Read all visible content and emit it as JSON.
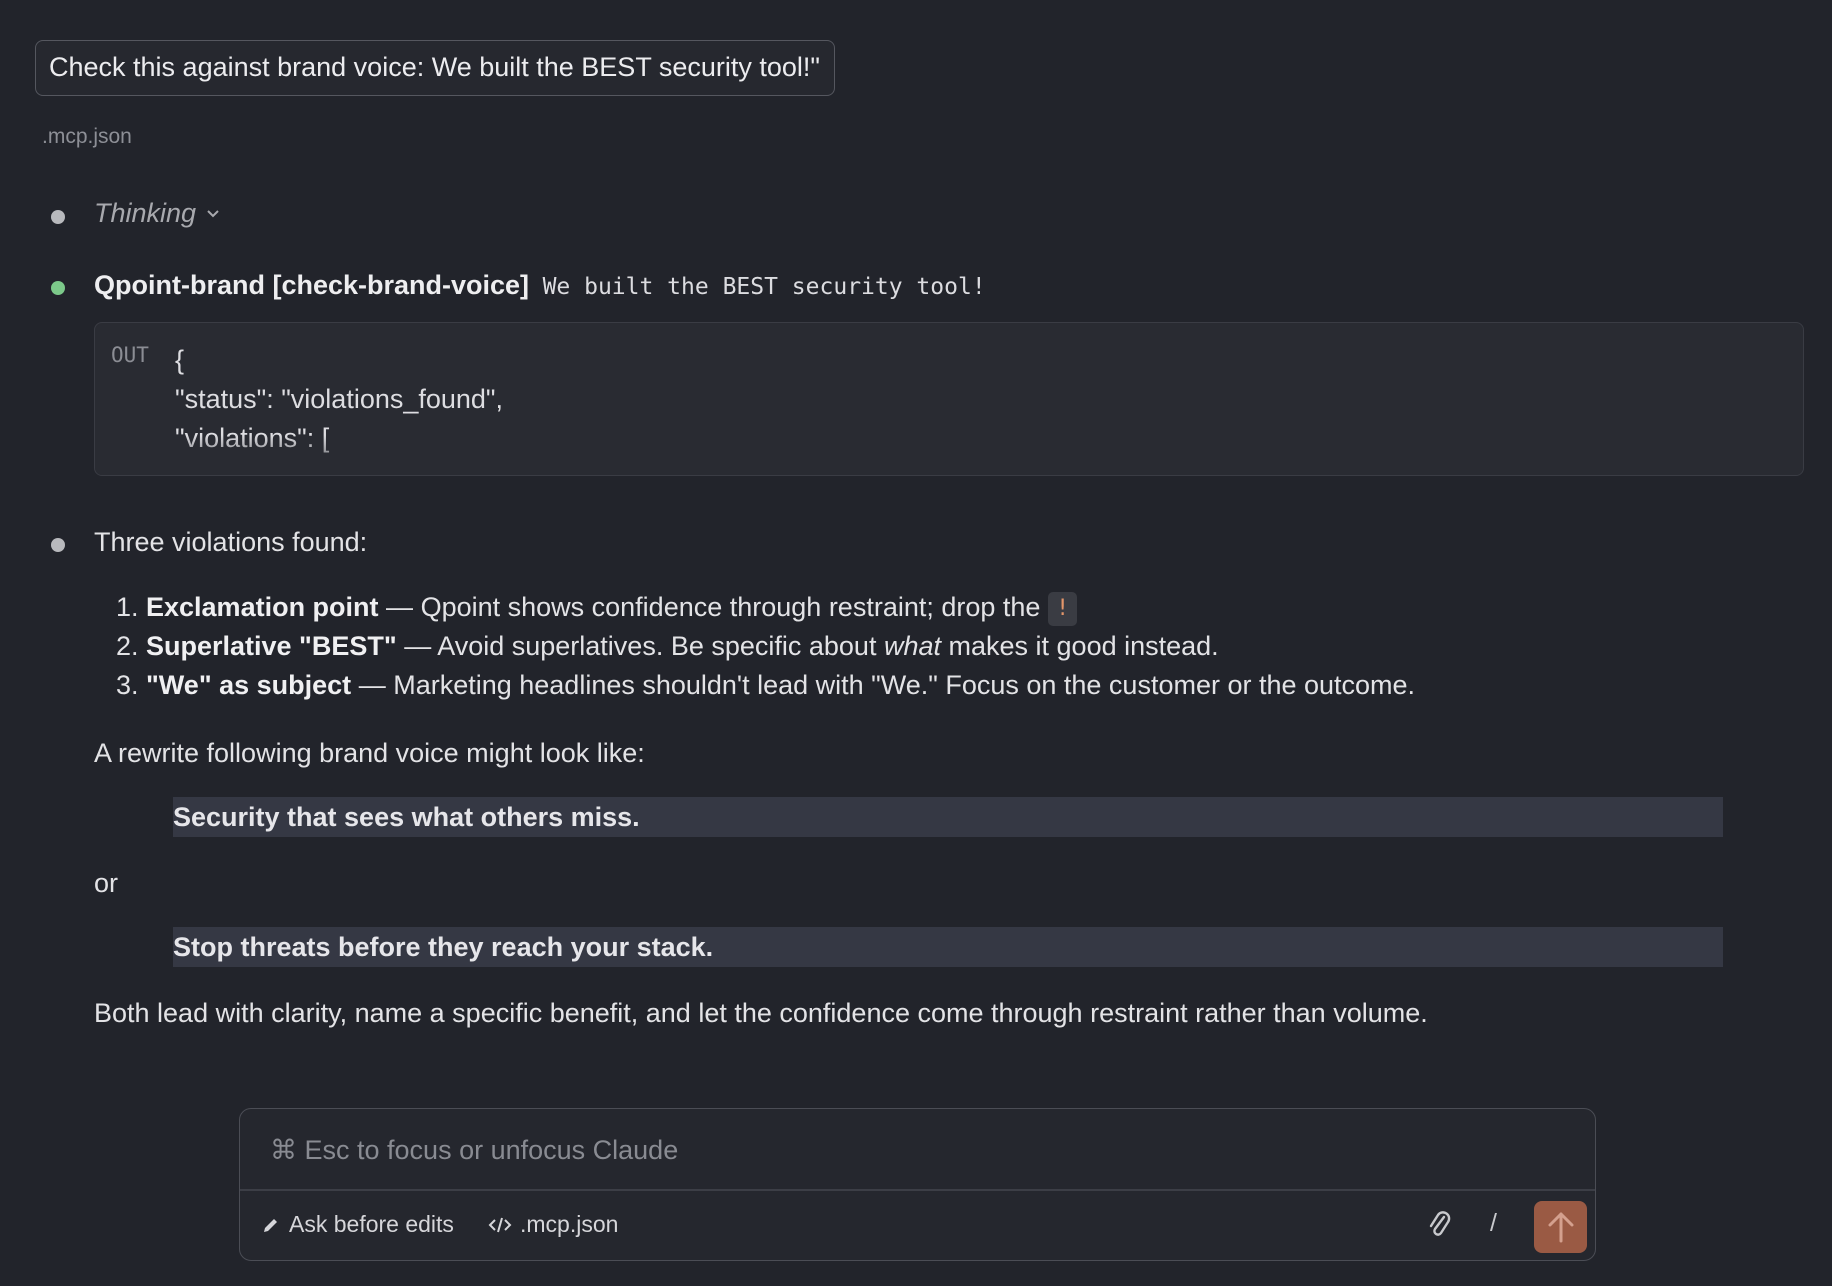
{
  "user_message": "Check this against brand voice: We built the BEST security tool!\"",
  "context_file": ".mcp.json",
  "thinking_label": "Thinking",
  "tool_call": {
    "name": "Qpoint-brand [check-brand-voice]",
    "argument": "We built the BEST security tool!",
    "output_label": "OUT",
    "output_text": "{\n\"status\": \"violations_found\",\n\"violations\": ["
  },
  "response": {
    "intro": "Three violations found:",
    "violations": [
      {
        "title": "Exclamation point",
        "sep": " — ",
        "text": "Qpoint shows confidence through restraint; drop the ",
        "code": "!"
      },
      {
        "title": "Superlative \"BEST\"",
        "sep": " — ",
        "text_before": "Avoid superlatives. Be specific about ",
        "emphasis": "what",
        "text_after": " makes it good instead."
      },
      {
        "title": "\"We\" as subject",
        "sep": " — ",
        "text": "Marketing headlines shouldn't lead with \"We.\" Focus on the customer or the outcome."
      }
    ],
    "rewrite_intro": "A rewrite following brand voice might look like:",
    "rewrite_1": "Security that sees what others miss.",
    "or": "or",
    "rewrite_2": "Stop threats before they reach your stack.",
    "conclusion": "Both lead with clarity, name a specific benefit, and let the confidence come through restraint rather than volume."
  },
  "composer": {
    "placeholder": "⌘ Esc to focus or unfocus Claude",
    "mode_label": "Ask before edits",
    "file_label": ".mcp.json",
    "slash": "/"
  },
  "colors": {
    "background": "#22242b",
    "tool_dot": "#7cc98a",
    "send_button": "#9a5a44",
    "inline_code": "#e4966a"
  }
}
